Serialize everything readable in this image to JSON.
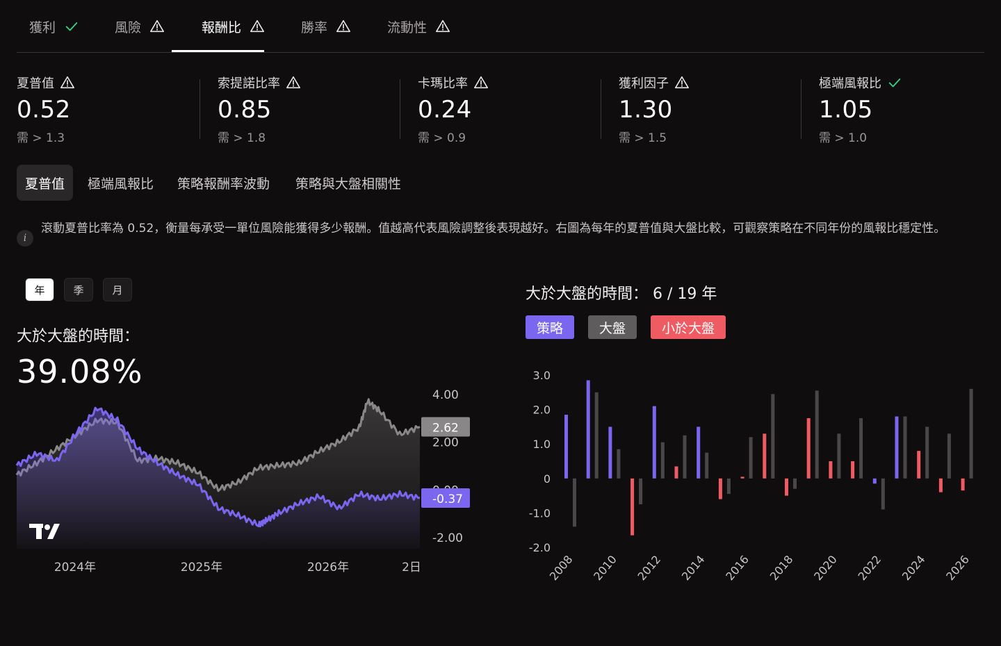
{
  "top_tabs": [
    {
      "label": "獲利",
      "status": "check"
    },
    {
      "label": "風險",
      "status": "warn"
    },
    {
      "label": "報酬比",
      "status": "warn",
      "active": true
    },
    {
      "label": "勝率",
      "status": "warn"
    },
    {
      "label": "流動性",
      "status": "warn"
    }
  ],
  "metrics": [
    {
      "title": "夏普值",
      "status": "warn",
      "value": "0.52",
      "req": "需 > 1.3"
    },
    {
      "title": "索提諾比率",
      "status": "warn",
      "value": "0.85",
      "req": "需 > 1.8"
    },
    {
      "title": "卡瑪比率",
      "status": "warn",
      "value": "0.24",
      "req": "需 > 0.9"
    },
    {
      "title": "獲利因子",
      "status": "warn",
      "value": "1.30",
      "req": "需 > 1.5"
    },
    {
      "title": "極端風報比",
      "status": "check",
      "value": "1.05",
      "req": "需 > 1.0"
    }
  ],
  "sub_tabs": [
    {
      "label": "夏普值",
      "active": true
    },
    {
      "label": "極端風報比"
    },
    {
      "label": "策略報酬率波動"
    },
    {
      "label": "策略與大盤相關性"
    }
  ],
  "info_text": "滾動夏普比率為 0.52，衡量每承受一單位風險能獲得多少報酬。值越高代表風險調整後表現越好。右圖為每年的夏普值與大盤比較，可觀察策略在不同年份的風報比穩定性。",
  "period_buttons": [
    {
      "label": "年",
      "active": true
    },
    {
      "label": "季"
    },
    {
      "label": "月"
    }
  ],
  "left_panel": {
    "label": "大於大盤的時間：",
    "value": "39.08%"
  },
  "right_panel": {
    "title": "大於大盤的時間： 6 / 19 年",
    "legend": [
      {
        "label": "策略",
        "color": "#7b66f0"
      },
      {
        "label": "大盤",
        "color": "#5f5c5e"
      },
      {
        "label": "小於大盤",
        "color": "#ee5b62"
      }
    ]
  },
  "colors": {
    "strategy": "#7b66f0",
    "market": "#8a8788",
    "below": "#ee5b62",
    "market_bar": "#4a4748",
    "warn": "#e8e6e6",
    "check": "#35d08a"
  },
  "chart_data": [
    {
      "type": "line",
      "title": "",
      "x_tick_labels": [
        "2024年",
        "2025年",
        "2026年",
        "2日"
      ],
      "y_tick_labels": [
        "4.00",
        "2.00",
        "0.00",
        "-2.00"
      ],
      "ylim": [
        -2.5,
        4.5
      ],
      "series": [
        {
          "name": "",
          "color": "#7b66f0",
          "x": [
            0,
            5,
            10,
            15,
            20,
            25,
            30,
            35,
            40,
            45,
            50,
            55,
            60,
            62,
            65,
            70,
            75,
            80,
            85,
            90,
            95,
            100
          ],
          "values": [
            1.0,
            1.5,
            1.2,
            2.4,
            3.4,
            2.9,
            1.7,
            1.1,
            0.6,
            0.2,
            -0.8,
            -1.1,
            -1.5,
            -1.3,
            -1.0,
            -0.6,
            -0.3,
            -0.8,
            -0.2,
            -0.4,
            -0.2,
            -0.37
          ]
        },
        {
          "name": "",
          "color": "#8a8788",
          "x": [
            0,
            5,
            10,
            15,
            20,
            25,
            30,
            35,
            40,
            45,
            50,
            55,
            60,
            65,
            70,
            75,
            80,
            85,
            87,
            90,
            95,
            100
          ],
          "values": [
            0.6,
            1.1,
            1.7,
            2.3,
            2.9,
            2.8,
            1.2,
            1.3,
            1.1,
            0.7,
            0.0,
            0.3,
            0.9,
            1.0,
            1.1,
            1.6,
            2.0,
            2.6,
            3.7,
            3.3,
            2.3,
            2.62
          ]
        }
      ],
      "last_value_labels": {
        "strategy": "-0.37",
        "market": "2.62"
      }
    },
    {
      "type": "bar",
      "title": "",
      "ylim": [
        -2.0,
        3.0
      ],
      "y_tick_labels": [
        "3.0",
        "2.0",
        "1.0",
        "0",
        "-1.0",
        "-2.0"
      ],
      "x_tick_labels": [
        "2008",
        "2010",
        "2012",
        "2014",
        "2016",
        "2018",
        "2020",
        "2022",
        "2024",
        "2026"
      ],
      "categories": [
        "2008",
        "2009",
        "2010",
        "2011",
        "2012",
        "2013",
        "2014",
        "2015",
        "2016",
        "2017",
        "2018",
        "2019",
        "2020",
        "2021",
        "2022",
        "2023",
        "2024",
        "2025",
        "2026"
      ],
      "series": [
        {
          "name": "策略",
          "values": [
            1.85,
            2.85,
            1.5,
            -1.65,
            2.1,
            0.35,
            1.5,
            -0.6,
            0.05,
            1.3,
            -0.5,
            1.75,
            0.5,
            0.5,
            -0.15,
            1.8,
            0.8,
            -0.4,
            -0.35
          ]
        },
        {
          "name": "大盤",
          "values": [
            -1.4,
            2.5,
            0.85,
            -0.75,
            1.05,
            1.25,
            0.75,
            -0.45,
            1.2,
            2.45,
            -0.3,
            2.55,
            1.3,
            1.75,
            -0.9,
            1.8,
            1.5,
            1.3,
            2.6
          ]
        }
      ]
    }
  ]
}
